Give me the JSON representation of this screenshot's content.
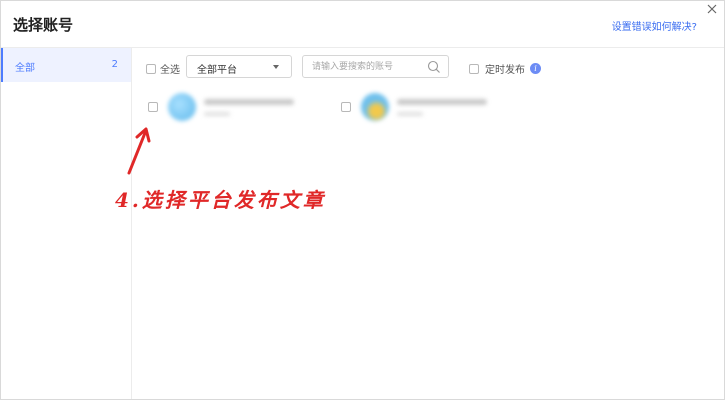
{
  "dialog": {
    "title": "选择账号",
    "help_link": "设置错误如何解决?"
  },
  "sidebar": {
    "items": [
      {
        "label": "全部",
        "count": "2"
      }
    ]
  },
  "toolbar": {
    "select_all_label": "全选",
    "platform_select_value": "全部平台",
    "search_placeholder": "请输入要搜索的账号",
    "schedule_label": "定时发布",
    "info_icon": "i"
  },
  "accounts": [
    {
      "avatar_color": "#7cc9f2"
    },
    {
      "avatar_color": "#6fc0ec"
    }
  ],
  "annotation": {
    "text": "4.选择平台发布文章",
    "color": "#e02828"
  },
  "colors": {
    "accent": "#4d7cfe",
    "link": "#3a6df0"
  },
  "icons": [
    "close-icon",
    "chevron-down-icon",
    "search-icon",
    "info-icon",
    "arrow-icon"
  ]
}
